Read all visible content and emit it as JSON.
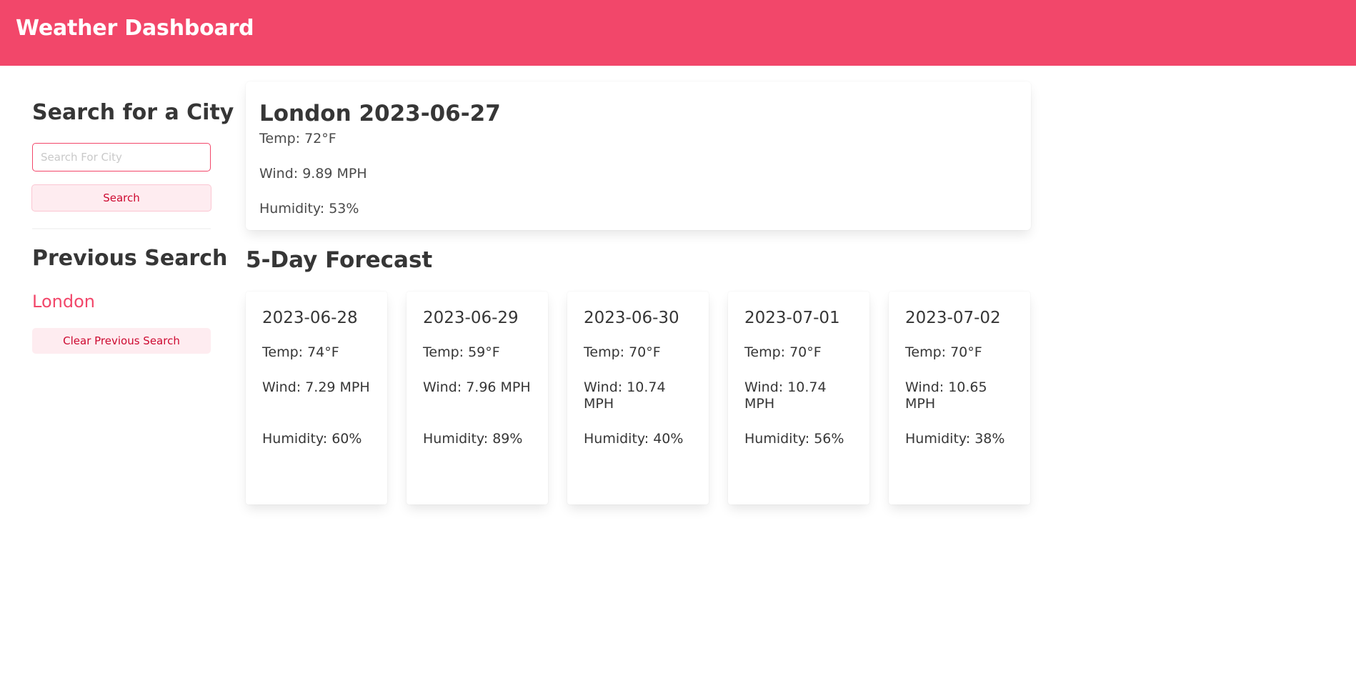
{
  "header": {
    "title": "Weather Dashboard",
    "color": "#f2476a"
  },
  "sidebar": {
    "search_title": "Search for a City",
    "search_placeholder": "Search For City",
    "search_value": "",
    "search_button": "Search",
    "previous_title": "Previous Search",
    "previous_items": [
      "London"
    ],
    "clear_button": "Clear Previous Search"
  },
  "current": {
    "title": "London 2023-06-27",
    "temp": "Temp: 72°F",
    "wind": "Wind: 9.89 MPH",
    "humidity": "Humidity: 53%"
  },
  "forecast": {
    "title": "5-Day Forecast",
    "days": [
      {
        "date": "2023-06-28",
        "temp": "Temp: 74°F",
        "wind": "Wind: 7.29 MPH",
        "humidity": "Humidity: 60%"
      },
      {
        "date": "2023-06-29",
        "temp": "Temp: 59°F",
        "wind": "Wind: 7.96 MPH",
        "humidity": "Humidity: 89%"
      },
      {
        "date": "2023-06-30",
        "temp": "Temp: 70°F",
        "wind": "Wind: 10.74 MPH",
        "humidity": "Humidity: 40%"
      },
      {
        "date": "2023-07-01",
        "temp": "Temp: 70°F",
        "wind": "Wind: 10.74 MPH",
        "humidity": "Humidity: 56%"
      },
      {
        "date": "2023-07-02",
        "temp": "Temp: 70°F",
        "wind": "Wind: 10.65 MPH",
        "humidity": "Humidity: 38%"
      }
    ]
  }
}
